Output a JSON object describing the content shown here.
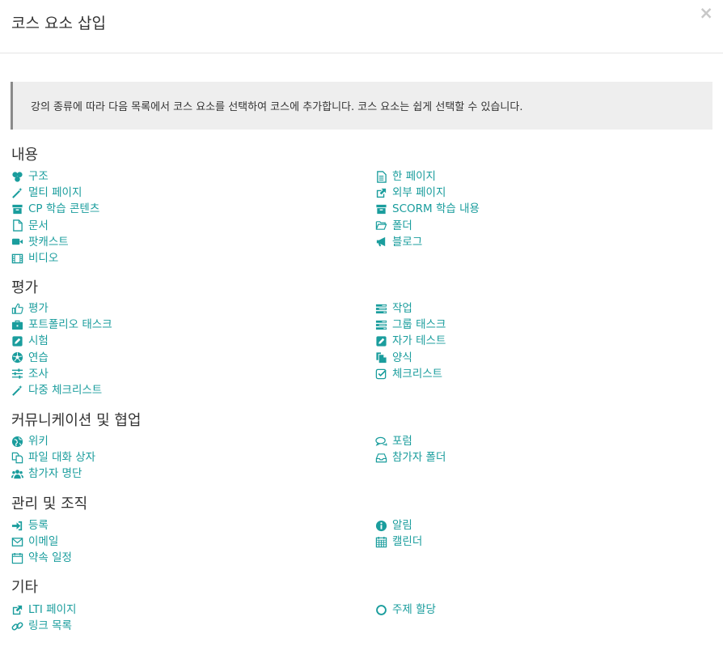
{
  "dialog": {
    "title": "코스 요소 삽입",
    "close_label": "×"
  },
  "info": "강의 종류에 따라 다음 목록에서 코스 요소를 선택하여 코스에 추가합니다. 코스 요소는 쉽게 선택할 수 있습니다.",
  "sections": [
    {
      "title": "내용",
      "items": [
        {
          "label": "구조",
          "icon": "structure-icon"
        },
        {
          "label": "한 페이지",
          "icon": "file-text-icon"
        },
        {
          "label": "멀티 페이지",
          "icon": "magic-wand-icon"
        },
        {
          "label": "외부 페이지",
          "icon": "external-link-icon"
        },
        {
          "label": "CP 학습 콘텐츠",
          "icon": "archive-icon"
        },
        {
          "label": "SCORM 학습 내용",
          "icon": "archive-icon"
        },
        {
          "label": "문서",
          "icon": "file-icon"
        },
        {
          "label": "폴더",
          "icon": "folder-open-icon"
        },
        {
          "label": "팟캐스트",
          "icon": "video-camera-icon"
        },
        {
          "label": "블로그",
          "icon": "bullhorn-icon"
        },
        {
          "label": "비디오",
          "icon": "film-icon"
        }
      ]
    },
    {
      "title": "평가",
      "items": [
        {
          "label": "평가",
          "icon": "thumbs-up-icon"
        },
        {
          "label": "작업",
          "icon": "tasks-icon"
        },
        {
          "label": "포트폴리오 태스크",
          "icon": "briefcase-icon"
        },
        {
          "label": "그룹 태스크",
          "icon": "tasks-icon"
        },
        {
          "label": "시험",
          "icon": "edit-icon"
        },
        {
          "label": "자가 테스트",
          "icon": "edit-icon"
        },
        {
          "label": "연습",
          "icon": "soccer-ball-icon"
        },
        {
          "label": "양식",
          "icon": "copy-icon"
        },
        {
          "label": "조사",
          "icon": "sliders-icon"
        },
        {
          "label": "체크리스트",
          "icon": "check-square-icon"
        },
        {
          "label": "다중 체크리스트",
          "icon": "magic-wand-icon"
        }
      ]
    },
    {
      "title": "커뮤니케이션 및 협업",
      "items": [
        {
          "label": "위키",
          "icon": "globe-icon"
        },
        {
          "label": "포럼",
          "icon": "comments-icon"
        },
        {
          "label": "파일 대화 상자",
          "icon": "files-icon"
        },
        {
          "label": "참가자 폴더",
          "icon": "inbox-icon"
        },
        {
          "label": "참가자 명단",
          "icon": "users-icon"
        }
      ]
    },
    {
      "title": "관리 및 조직",
      "items": [
        {
          "label": "등록",
          "icon": "sign-in-icon"
        },
        {
          "label": "알림",
          "icon": "info-circle-icon"
        },
        {
          "label": "이메일",
          "icon": "envelope-icon"
        },
        {
          "label": "캘린더",
          "icon": "calendar-icon"
        },
        {
          "label": "약속 일정",
          "icon": "calendar-empty-icon"
        }
      ]
    },
    {
      "title": "기타",
      "items": [
        {
          "label": "LTI 페이지",
          "icon": "external-link-icon"
        },
        {
          "label": "주제 할당",
          "icon": "circle-icon"
        },
        {
          "label": "링크 목록",
          "icon": "link-icon"
        }
      ]
    }
  ],
  "colors": {
    "link": "#1a9d9d",
    "text": "#333333",
    "info_bg": "#eeeeee",
    "info_border": "#8a8a8a"
  }
}
